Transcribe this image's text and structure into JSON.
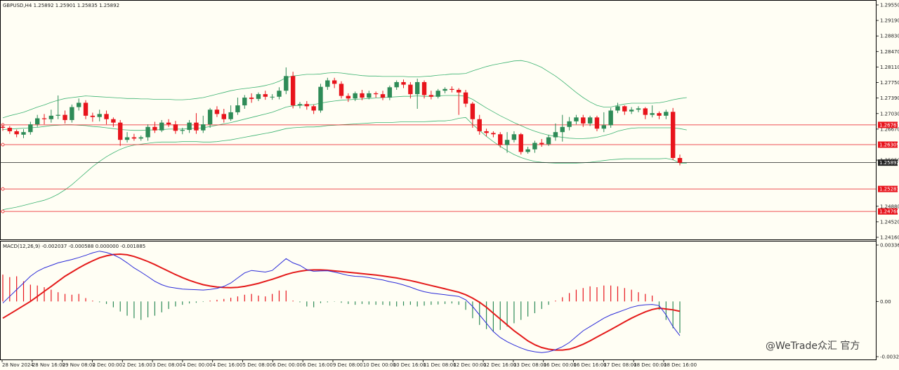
{
  "header": {
    "symbol_info": "GBPUSD,H4  1.25892 1.25901 1.25835 1.25892",
    "macd_info": "MACD(12,26,9) -0.002037 -0.000588 0.000000 -0.001885"
  },
  "watermark": "@WeTrade众汇 官方",
  "colors": {
    "background": "#fffef4",
    "bull": "#2e8b57",
    "bear": "#e8141c",
    "band": "#3cb371",
    "macd": "#2b2bd9",
    "signal": "#e41a1a"
  },
  "chart_data": {
    "type": "candlestick",
    "price_axis": {
      "ylim": [
        1.2416,
        1.2955
      ],
      "ticks": [
        "1.29550",
        "1.29190",
        "1.28830",
        "1.28470",
        "1.28110",
        "1.27750",
        "1.27390",
        "1.27030",
        "1.26670",
        "1.25950",
        "1.24880",
        "1.24520",
        "1.24160"
      ]
    },
    "x_labels": [
      "28 Nov 2024",
      "28 Nov 16:00",
      "29 Nov 08:00",
      "2 Dec 00:00",
      "2 Dec 16:00",
      "3 Dec 08:00",
      "4 Dec 00:00",
      "4 Dec 16:00",
      "5 Dec 08:00",
      "6 Dec 00:00",
      "6 Dec 16:00",
      "9 Dec 08:00",
      "10 Dec 00:00",
      "10 Dec 16:00",
      "11 Dec 08:00",
      "12 Dec 00:00",
      "12 Dec 16:00",
      "13 Dec 08:00",
      "16 Dec 00:00",
      "16 Dec 16:00",
      "17 Dec 08:00",
      "18 Dec 00:00",
      "18 Dec 16:00"
    ],
    "levels": [
      {
        "value": 1.26767,
        "label": "1.26767",
        "color": "#e8141c"
      },
      {
        "value": 1.26309,
        "label": "1.26309",
        "color": "#e8141c"
      },
      {
        "value": 1.25892,
        "label": "1.25892",
        "color": "#222222"
      },
      {
        "value": 1.25281,
        "label": "1.25281",
        "color": "#e8141c"
      },
      {
        "value": 1.2476,
        "label": "1.24760",
        "color": "#e8141c"
      }
    ],
    "candles": [
      [
        1.2672,
        1.267,
        1.2663,
        1.2678
      ],
      [
        1.267,
        1.2662,
        1.2656,
        1.2674
      ],
      [
        1.2662,
        1.2655,
        1.2648,
        1.2666
      ],
      [
        1.2654,
        1.266,
        1.2646,
        1.2667
      ],
      [
        1.266,
        1.2678,
        1.2654,
        1.2684
      ],
      [
        1.2678,
        1.2692,
        1.2672,
        1.27
      ],
      [
        1.2692,
        1.269,
        1.2678,
        1.2702
      ],
      [
        1.269,
        1.2698,
        1.2682,
        1.2712
      ],
      [
        1.2698,
        1.27,
        1.269,
        1.2745
      ],
      [
        1.27,
        1.2688,
        1.268,
        1.271
      ],
      [
        1.2688,
        1.2718,
        1.2682,
        1.2724
      ],
      [
        1.2718,
        1.2728,
        1.271,
        1.2738
      ],
      [
        1.2728,
        1.2698,
        1.269,
        1.2734
      ],
      [
        1.2698,
        1.2695,
        1.2684,
        1.2705
      ],
      [
        1.2695,
        1.2702,
        1.2685,
        1.2712
      ],
      [
        1.2702,
        1.269,
        1.2678,
        1.271
      ],
      [
        1.269,
        1.2682,
        1.2672,
        1.2694
      ],
      [
        1.2682,
        1.2642,
        1.2628,
        1.2688
      ],
      [
        1.2642,
        1.2648,
        1.2636,
        1.266
      ],
      [
        1.2648,
        1.2645,
        1.264,
        1.2656
      ],
      [
        1.2645,
        1.2648,
        1.264,
        1.2652
      ],
      [
        1.2648,
        1.2672,
        1.264,
        1.2678
      ],
      [
        1.2672,
        1.2664,
        1.2658,
        1.2684
      ],
      [
        1.2664,
        1.2682,
        1.266,
        1.2688
      ],
      [
        1.2682,
        1.2678,
        1.2672,
        1.269
      ],
      [
        1.2678,
        1.2663,
        1.2656,
        1.2686
      ],
      [
        1.2663,
        1.2665,
        1.2655,
        1.267
      ],
      [
        1.2665,
        1.2682,
        1.2658,
        1.2688
      ],
      [
        1.2682,
        1.2664,
        1.2656,
        1.2704
      ],
      [
        1.2664,
        1.2678,
        1.2658,
        1.2698
      ],
      [
        1.2678,
        1.2712,
        1.267,
        1.2716
      ],
      [
        1.2712,
        1.2702,
        1.2695,
        1.272
      ],
      [
        1.2702,
        1.269,
        1.2682,
        1.2714
      ],
      [
        1.269,
        1.2706,
        1.2686,
        1.2722
      ],
      [
        1.2706,
        1.2722,
        1.27,
        1.274
      ],
      [
        1.2722,
        1.274,
        1.2714,
        1.2746
      ],
      [
        1.274,
        1.2737,
        1.2728,
        1.275
      ],
      [
        1.2737,
        1.2748,
        1.2732,
        1.2752
      ],
      [
        1.2748,
        1.2742,
        1.2735,
        1.2756
      ],
      [
        1.2742,
        1.2742,
        1.2735,
        1.2748
      ],
      [
        1.2742,
        1.2756,
        1.2736,
        1.2764
      ],
      [
        1.2756,
        1.279,
        1.2748,
        1.281
      ],
      [
        1.279,
        1.2722,
        1.2715,
        1.28
      ],
      [
        1.2722,
        1.2725,
        1.2715,
        1.273
      ],
      [
        1.2725,
        1.272,
        1.2712,
        1.2732
      ],
      [
        1.272,
        1.271,
        1.2702,
        1.2724
      ],
      [
        1.271,
        1.2765,
        1.2705,
        1.2772
      ],
      [
        1.2765,
        1.278,
        1.2758,
        1.2786
      ],
      [
        1.278,
        1.2772,
        1.2762,
        1.2786
      ],
      [
        1.2772,
        1.2744,
        1.2738,
        1.2778
      ],
      [
        1.2744,
        1.2738,
        1.273,
        1.275
      ],
      [
        1.2738,
        1.275,
        1.2732,
        1.2754
      ],
      [
        1.275,
        1.274,
        1.2734,
        1.2758
      ],
      [
        1.274,
        1.275,
        1.2736,
        1.2756
      ],
      [
        1.275,
        1.2748,
        1.274,
        1.2754
      ],
      [
        1.2748,
        1.274,
        1.2734,
        1.2756
      ],
      [
        1.274,
        1.2764,
        1.2734,
        1.2768
      ],
      [
        1.2764,
        1.2776,
        1.2758,
        1.278
      ],
      [
        1.2776,
        1.277,
        1.2762,
        1.2782
      ],
      [
        1.277,
        1.2748,
        1.2738,
        1.2776
      ],
      [
        1.2748,
        1.2776,
        1.2714,
        1.2784
      ],
      [
        1.2776,
        1.2746,
        1.2738,
        1.278
      ],
      [
        1.2746,
        1.2742,
        1.2736,
        1.2756
      ],
      [
        1.2742,
        1.2756,
        1.2738,
        1.276
      ],
      [
        1.2756,
        1.276,
        1.275,
        1.2764
      ],
      [
        1.276,
        1.2758,
        1.2752,
        1.2766
      ],
      [
        1.2758,
        1.2752,
        1.27,
        1.2762
      ],
      [
        1.2752,
        1.2726,
        1.2718,
        1.2758
      ],
      [
        1.2726,
        1.269,
        1.267,
        1.273
      ],
      [
        1.269,
        1.2662,
        1.2654,
        1.27
      ],
      [
        1.2662,
        1.2658,
        1.265,
        1.2668
      ],
      [
        1.2658,
        1.2655,
        1.2648,
        1.2662
      ],
      [
        1.2655,
        1.263,
        1.2624,
        1.266
      ],
      [
        1.263,
        1.2642,
        1.2612,
        1.266
      ],
      [
        1.2642,
        1.2655,
        1.2636,
        1.2662
      ],
      [
        1.2655,
        1.2614,
        1.2608,
        1.2658
      ],
      [
        1.2614,
        1.262,
        1.261,
        1.2626
      ],
      [
        1.262,
        1.2635,
        1.2612,
        1.264
      ],
      [
        1.2635,
        1.2632,
        1.2626,
        1.2644
      ],
      [
        1.2632,
        1.2648,
        1.2628,
        1.2654
      ],
      [
        1.2648,
        1.266,
        1.264,
        1.268
      ],
      [
        1.266,
        1.2672,
        1.2638,
        1.27
      ],
      [
        1.2672,
        1.2685,
        1.2664,
        1.2695
      ],
      [
        1.2685,
        1.2694,
        1.2678,
        1.27
      ],
      [
        1.2694,
        1.268,
        1.2672,
        1.27
      ],
      [
        1.268,
        1.2694,
        1.2674,
        1.2698
      ],
      [
        1.2694,
        1.2668,
        1.2662,
        1.2698
      ],
      [
        1.2668,
        1.2676,
        1.266,
        1.2706
      ],
      [
        1.2676,
        1.271,
        1.267,
        1.2716
      ],
      [
        1.271,
        1.272,
        1.2704,
        1.2728
      ],
      [
        1.272,
        1.2708,
        1.27,
        1.2722
      ],
      [
        1.2708,
        1.2712,
        1.2702,
        1.2718
      ],
      [
        1.2712,
        1.2715,
        1.2706,
        1.272
      ],
      [
        1.2715,
        1.27,
        1.269,
        1.2718
      ],
      [
        1.27,
        1.2704,
        1.2694,
        1.2722
      ],
      [
        1.2704,
        1.2698,
        1.269,
        1.2708
      ],
      [
        1.2698,
        1.2707,
        1.269,
        1.2712
      ],
      [
        1.2707,
        1.26,
        1.2595,
        1.2716
      ],
      [
        1.26,
        1.2589,
        1.2583,
        1.2608
      ]
    ],
    "bands": {
      "upper": [
        1.2693,
        1.2698,
        1.2702,
        1.2706,
        1.2712,
        1.2718,
        1.2723,
        1.2729,
        1.2734,
        1.2738,
        1.274,
        1.2742,
        1.2744,
        1.2743,
        1.2742,
        1.2741,
        1.274,
        1.2739,
        1.2738,
        1.2738,
        1.2737,
        1.2737,
        1.2736,
        1.2736,
        1.2736,
        1.2735,
        1.2735,
        1.2736,
        1.2738,
        1.274,
        1.2744,
        1.2748,
        1.2752,
        1.2756,
        1.2759,
        1.2761,
        1.2763,
        1.2765,
        1.2768,
        1.2772,
        1.2778,
        1.2786,
        1.279,
        1.2792,
        1.2794,
        1.2794,
        1.2795,
        1.2797,
        1.2798,
        1.2797,
        1.2795,
        1.2793,
        1.2791,
        1.279,
        1.279,
        1.2789,
        1.2789,
        1.2789,
        1.2789,
        1.2788,
        1.2788,
        1.2789,
        1.279,
        1.2792,
        1.2793,
        1.2795,
        1.2795,
        1.2796,
        1.2802,
        1.2807,
        1.2812,
        1.2816,
        1.2819,
        1.2822,
        1.2825,
        1.2826,
        1.2823,
        1.2817,
        1.281,
        1.28,
        1.279,
        1.2778,
        1.2765,
        1.2752,
        1.274,
        1.273,
        1.2722,
        1.2718,
        1.2718,
        1.2722,
        1.2725,
        1.2727,
        1.2727,
        1.2727,
        1.2727,
        1.2728,
        1.2731,
        1.2735,
        1.2738,
        1.274
      ],
      "middle": [
        1.2666,
        1.2667,
        1.2668,
        1.2669,
        1.267,
        1.2671,
        1.2673,
        1.2675,
        1.2676,
        1.2677,
        1.2677,
        1.2676,
        1.2675,
        1.2673,
        1.2672,
        1.267,
        1.2668,
        1.2666,
        1.2665,
        1.2664,
        1.2664,
        1.2665,
        1.2665,
        1.2666,
        1.2667,
        1.2667,
        1.2667,
        1.2668,
        1.2669,
        1.267,
        1.2673,
        1.2676,
        1.2679,
        1.2682,
        1.2686,
        1.269,
        1.2694,
        1.2698,
        1.2702,
        1.2706,
        1.2712,
        1.2718,
        1.2721,
        1.2722,
        1.2723,
        1.2724,
        1.2727,
        1.273,
        1.2732,
        1.2734,
        1.2735,
        1.2736,
        1.2737,
        1.2738,
        1.2739,
        1.274,
        1.2741,
        1.2742,
        1.2743,
        1.2743,
        1.2744,
        1.2743,
        1.2743,
        1.2744,
        1.2745,
        1.2745,
        1.2745,
        1.2743,
        1.2736,
        1.2726,
        1.2716,
        1.2707,
        1.2698,
        1.269,
        1.2682,
        1.2675,
        1.2668,
        1.2662,
        1.2657,
        1.2653,
        1.265,
        1.2648,
        1.2646,
        1.2645,
        1.2645,
        1.2646,
        1.2648,
        1.2652,
        1.2656,
        1.2662,
        1.2666,
        1.2669,
        1.267,
        1.267,
        1.267,
        1.267,
        1.267,
        1.267,
        1.2668,
        1.2665
      ],
      "lower": [
        1.248,
        1.2483,
        1.2486,
        1.249,
        1.2494,
        1.2498,
        1.2502,
        1.2508,
        1.2516,
        1.2526,
        1.2538,
        1.2552,
        1.2566,
        1.258,
        1.2592,
        1.2603,
        1.2612,
        1.262,
        1.2626,
        1.263,
        1.2632,
        1.2634,
        1.2636,
        1.2637,
        1.2637,
        1.2637,
        1.2638,
        1.2638,
        1.2638,
        1.2637,
        1.2637,
        1.2638,
        1.264,
        1.2642,
        1.2645,
        1.2648,
        1.2651,
        1.2654,
        1.2657,
        1.266,
        1.2664,
        1.2668,
        1.267,
        1.2671,
        1.2672,
        1.2672,
        1.2673,
        1.2675,
        1.2676,
        1.2677,
        1.2678,
        1.2679,
        1.268,
        1.2681,
        1.2682,
        1.2682,
        1.2682,
        1.2683,
        1.2684,
        1.2684,
        1.2684,
        1.2684,
        1.2685,
        1.2686,
        1.2686,
        1.2688,
        1.2692,
        1.2694,
        1.2678,
        1.2664,
        1.265,
        1.2638,
        1.2627,
        1.2617,
        1.2608,
        1.2601,
        1.2596,
        1.2592,
        1.259,
        1.2589,
        1.2588,
        1.2588,
        1.2588,
        1.2588,
        1.2589,
        1.259,
        1.2592,
        1.2594,
        1.2596,
        1.2597,
        1.2598,
        1.2598,
        1.2598,
        1.2598,
        1.2598,
        1.2598,
        1.2599,
        1.2596,
        1.2588,
        1.2588
      ]
    },
    "macd": {
      "ylim": [
        -0.003293,
        0.003364
      ],
      "ticks": [
        "0.003364",
        "0.00",
        "-0.003293"
      ],
      "histogram": [
        0.0016,
        0.00145,
        0.0015,
        0.0012,
        0.001,
        0.00095,
        0.00085,
        0.0007,
        0.00055,
        0.00045,
        0.0004,
        0.00045,
        0.0002,
        5e-05,
        -5e-05,
        -0.00015,
        -0.00035,
        -0.0006,
        -0.00085,
        -0.001,
        -0.0011,
        -0.00095,
        -0.00085,
        -0.00065,
        -0.00045,
        -0.0003,
        -0.0002,
        -0.00012,
        -8e-05,
        -3e-05,
        5e-05,
        0.0001,
        0.00015,
        0.00022,
        0.0003,
        0.0004,
        0.00045,
        0.00035,
        0.0003,
        0.00045,
        0.00065,
        0.00065,
        5e-05,
        -5e-05,
        -0.0003,
        -0.00035,
        -0.0001,
        -5e-05,
        -2e-05,
        -8e-05,
        -0.00015,
        -0.0002,
        -0.00015,
        -0.00018,
        -0.0002,
        -0.0002,
        -0.00025,
        -0.0003,
        -0.00025,
        -0.0002,
        -0.0003,
        -0.00025,
        -0.0002,
        -0.00018,
        -0.00015,
        -0.00012,
        -0.0002,
        -0.0005,
        -0.001,
        -0.0014,
        -0.00165,
        -0.0018,
        -0.0017,
        -0.0015,
        -0.0013,
        -0.0011,
        -0.0009,
        -0.0007,
        -0.00045,
        -0.0002,
        5e-05,
        0.00025,
        0.0005,
        0.0007,
        0.0008,
        0.0009,
        0.00085,
        0.00095,
        0.00095,
        0.0009,
        0.0008,
        0.0007,
        0.00055,
        0.00045,
        0.00035,
        -0.0005,
        -0.0011,
        -0.0016,
        -0.00188
      ],
      "macd_line": [
        -0.0001,
        0.0003,
        0.0007,
        0.0011,
        0.0015,
        0.0018,
        0.002,
        0.00215,
        0.0023,
        0.0024,
        0.0025,
        0.00262,
        0.00275,
        0.0029,
        0.003,
        0.00292,
        0.00278,
        0.00258,
        0.0023,
        0.002,
        0.00175,
        0.00148,
        0.0012,
        0.001,
        0.00086,
        0.0008,
        0.00074,
        0.00072,
        0.0007,
        0.00068,
        0.00072,
        0.00078,
        0.0009,
        0.0011,
        0.0014,
        0.0017,
        0.00185,
        0.0018,
        0.00175,
        0.00185,
        0.0022,
        0.00255,
        0.0023,
        0.00215,
        0.0019,
        0.0018,
        0.00182,
        0.00183,
        0.00175,
        0.00165,
        0.00155,
        0.0015,
        0.00148,
        0.00142,
        0.00135,
        0.00128,
        0.00118,
        0.0011,
        0.00098,
        0.00085,
        0.0007,
        0.00058,
        0.0005,
        0.00045,
        0.0004,
        0.00035,
        0.0003,
        0.0001,
        -0.0003,
        -0.0008,
        -0.0013,
        -0.0018,
        -0.00215,
        -0.0024,
        -0.0026,
        -0.00278,
        -0.00292,
        -0.003,
        -0.00305,
        -0.003,
        -0.00288,
        -0.0027,
        -0.00245,
        -0.0021,
        -0.00175,
        -0.0015,
        -0.00125,
        -0.001,
        -0.0008,
        -0.00065,
        -0.0005,
        -0.00035,
        -0.00025,
        -0.0002,
        -0.00018,
        -0.00025,
        -0.0008,
        -0.0015,
        -0.00204
      ],
      "signal_line": [
        -0.001,
        -0.00075,
        -0.0005,
        -0.00025,
        0.0,
        0.0003,
        0.0006,
        0.0009,
        0.0012,
        0.0015,
        0.00175,
        0.002,
        0.00222,
        0.00242,
        0.0026,
        0.00272,
        0.0028,
        0.00282,
        0.00278,
        0.00268,
        0.00254,
        0.00238,
        0.0022,
        0.002,
        0.0018,
        0.0016,
        0.00142,
        0.00126,
        0.00112,
        0.001,
        0.00092,
        0.00086,
        0.00083,
        0.00082,
        0.00084,
        0.0009,
        0.00098,
        0.00108,
        0.0012,
        0.00132,
        0.00146,
        0.0016,
        0.00172,
        0.0018,
        0.00186,
        0.00188,
        0.00188,
        0.00186,
        0.00182,
        0.00178,
        0.00174,
        0.0017,
        0.00166,
        0.00162,
        0.00157,
        0.00152,
        0.00146,
        0.0014,
        0.00132,
        0.00124,
        0.00115,
        0.00105,
        0.00095,
        0.00085,
        0.00075,
        0.00065,
        0.00055,
        0.0004,
        0.0002,
        -5e-05,
        -0.00035,
        -0.0007,
        -0.00105,
        -0.0014,
        -0.00175,
        -0.00205,
        -0.00235,
        -0.00258,
        -0.00275,
        -0.00285,
        -0.0029,
        -0.0029,
        -0.00285,
        -0.00272,
        -0.00255,
        -0.00235,
        -0.00212,
        -0.0019,
        -0.00168,
        -0.00145,
        -0.00122,
        -0.001,
        -0.0008,
        -0.00062,
        -0.00048,
        -0.0004,
        -0.00045,
        -0.0005,
        -0.00059
      ]
    }
  }
}
